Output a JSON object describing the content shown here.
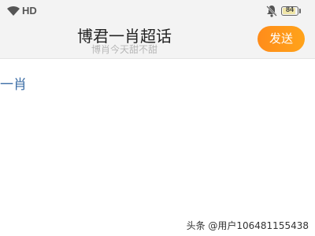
{
  "status_bar": {
    "network": "HD",
    "battery_level": "84",
    "icons": [
      "wifi-icon",
      "bell-muted-icon",
      "battery-icon"
    ]
  },
  "header": {
    "title": "博君一肖超话",
    "subtitle": "博肖今天甜不甜",
    "send_label": "发送"
  },
  "content": {
    "text": "一肖"
  },
  "watermark": "头条 @用户106481155438",
  "colors": {
    "accent": "#ff9a1a",
    "link": "#3c6ea6",
    "bar_bg": "#f3f3f3"
  }
}
